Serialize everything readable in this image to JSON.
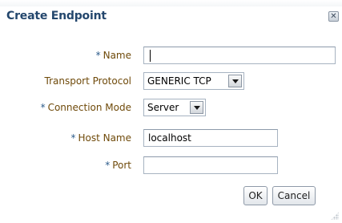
{
  "dialog": {
    "title": "Create Endpoint",
    "close_icon": "close-icon",
    "close_glyph": "✕"
  },
  "form": {
    "required_marker": "*",
    "name": {
      "label": "Name",
      "value": ""
    },
    "transport_protocol": {
      "label": "Transport Protocol",
      "value": "GENERIC TCP"
    },
    "connection_mode": {
      "label": "Connection Mode",
      "value": "Server"
    },
    "host_name": {
      "label": "Host Name",
      "value": "localhost"
    },
    "port": {
      "label": "Port",
      "value": ""
    }
  },
  "buttons": {
    "ok": "OK",
    "cancel": "Cancel"
  },
  "colors": {
    "title": "#24476d",
    "label": "#6f4a0a",
    "required_marker": "#2c5b8a"
  }
}
